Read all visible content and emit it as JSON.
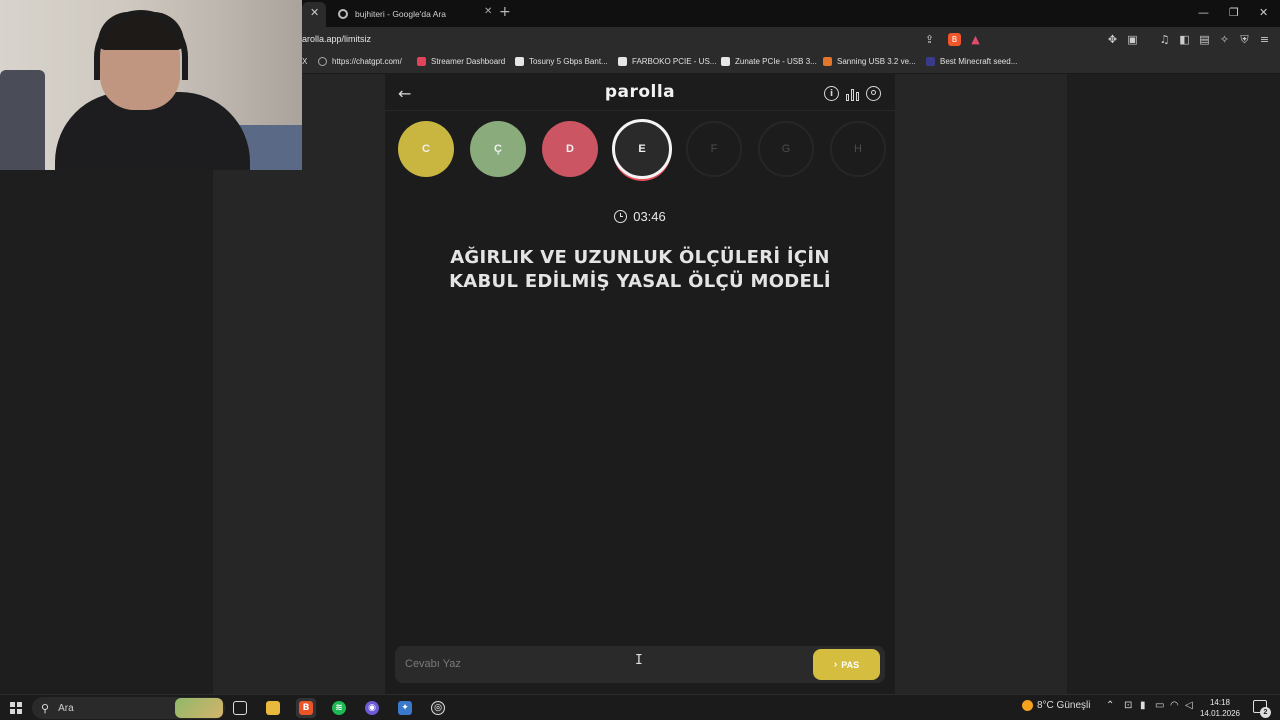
{
  "browser": {
    "tabs": [
      {
        "label": "",
        "close": "✕"
      },
      {
        "label": "bujhiteri - Google'da Ara",
        "close": "✕"
      }
    ],
    "new_tab": "+",
    "window_controls": {
      "minimize": "—",
      "restore": "❐",
      "close": "✕"
    },
    "url": "arolla.app/limitsiz",
    "bookmarks_overflow_left": "X",
    "bookmarks": [
      {
        "label": "https://chatgpt.com/",
        "color": "#aaaaaa"
      },
      {
        "label": "Streamer Dashboard",
        "color": "#e0435a"
      },
      {
        "label": "Tosuny 5 Gbps Bant...",
        "color": "#e6e6e6"
      },
      {
        "label": "FARBOKO PCIE - US...",
        "color": "#e6e6e6"
      },
      {
        "label": "Zunate PCIe - USB 3...",
        "color": "#e6e6e6"
      },
      {
        "label": "Sanning USB 3.2 ve...",
        "color": "#e2762b"
      },
      {
        "label": "Best Minecraft seed...",
        "color": "#3a3a8a"
      }
    ]
  },
  "app": {
    "logo": "parolla",
    "back_icon": "←",
    "info_icon": "i",
    "letters": [
      {
        "letter": "C",
        "state": "correct",
        "color": "#c9b640"
      },
      {
        "letter": "Ç",
        "state": "correct",
        "color": "#8aab7c"
      },
      {
        "letter": "D",
        "state": "wrong",
        "color": "#cc5563"
      },
      {
        "letter": "E",
        "state": "active",
        "color": "#2a2a2a"
      },
      {
        "letter": "F",
        "state": "pending",
        "color": "#1c1c1c"
      },
      {
        "letter": "G",
        "state": "pending",
        "color": "#1c1c1c"
      },
      {
        "letter": "H",
        "state": "pending",
        "color": "#1c1c1c"
      }
    ],
    "timer": "03:46",
    "question_line1": "AĞIRLIK VE UZUNLUK ÖLÇÜLERİ İÇİN",
    "question_line2": "KABUL EDİLMİŞ YASAL ÖLÇÜ MODELİ",
    "answer_placeholder": "Cevabı Yaz",
    "answer_value": "",
    "pass_label": "PAS",
    "pass_icon": "›",
    "accent": "#d4bd3f"
  },
  "taskbar": {
    "search_label": "Ara",
    "search_icon": "⚲",
    "weather": "8°C Güneşli",
    "time": "14:18",
    "date": "14.01.2026",
    "notification_count": "2",
    "apps": [
      {
        "name": "task-view",
        "glyph": "▣",
        "color": "#2b2b2b"
      },
      {
        "name": "file-explorer",
        "glyph": "▬",
        "color": "#e8b93c"
      },
      {
        "name": "brave",
        "glyph": "B",
        "color": "#e9542b"
      },
      {
        "name": "spotify",
        "glyph": "≋",
        "color": "#1db954"
      },
      {
        "name": "discord",
        "glyph": "◉",
        "color": "#6d5bd6"
      },
      {
        "name": "app-blue",
        "glyph": "✦",
        "color": "#3a78c9"
      },
      {
        "name": "obs",
        "glyph": "◎",
        "color": "#2c2c2c"
      }
    ]
  }
}
